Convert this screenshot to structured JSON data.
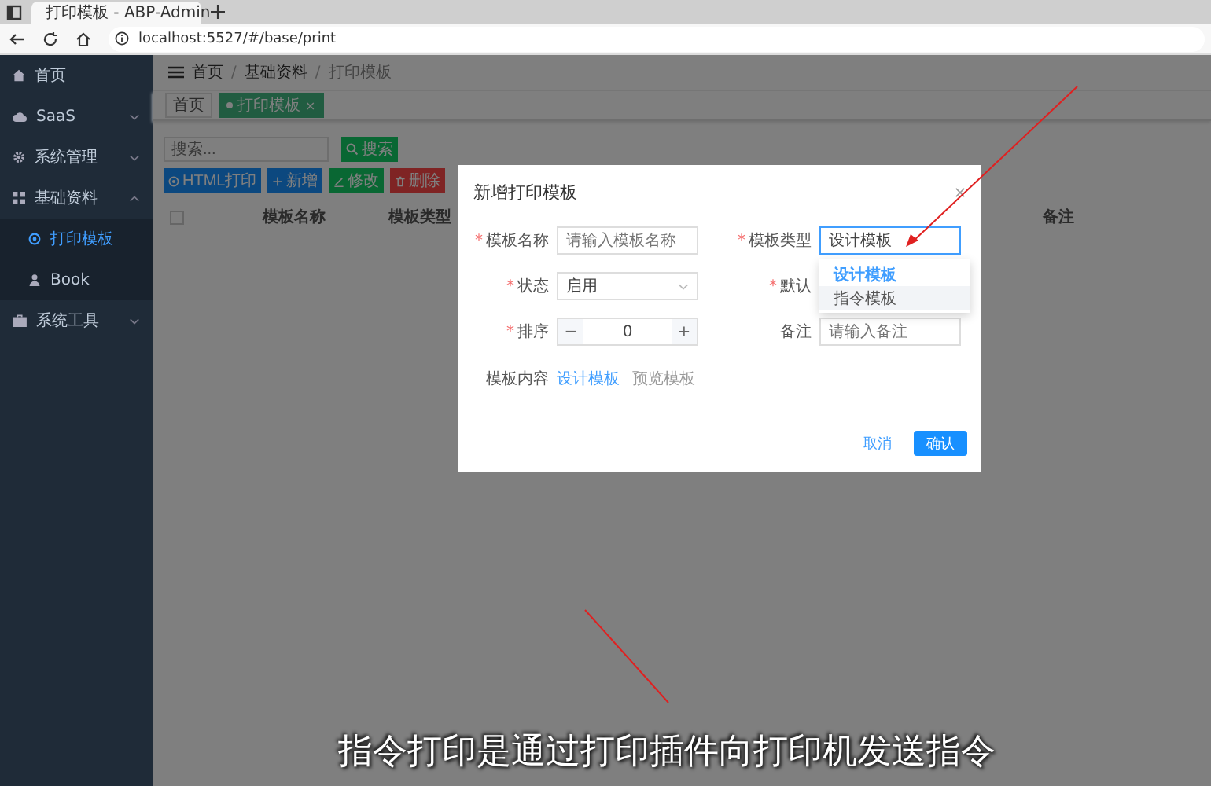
{
  "browser": {
    "tab_title": "打印模板 - ABP-Admin",
    "url": "localhost:5527/#/base/print"
  },
  "sidebar": {
    "items": [
      {
        "label": "首页"
      },
      {
        "label": "SaaS",
        "expanded": false
      },
      {
        "label": "系统管理",
        "expanded": false
      },
      {
        "label": "基础资料",
        "expanded": true,
        "children": [
          {
            "label": "打印模板",
            "selected": true
          },
          {
            "label": "Book",
            "selected": false
          }
        ]
      },
      {
        "label": "系统工具",
        "expanded": false
      }
    ]
  },
  "breadcrumb": {
    "separator": "/",
    "items": [
      "首页",
      "基础资料",
      "打印模板"
    ]
  },
  "tags": [
    {
      "label": "首页",
      "selected": false
    },
    {
      "label": "打印模板",
      "selected": true,
      "close": "×"
    }
  ],
  "search": {
    "placeholder": "搜索...",
    "button": "搜索"
  },
  "toolbar": [
    {
      "label": "HTML打印",
      "kind": "print"
    },
    {
      "label": "新增",
      "kind": "add"
    },
    {
      "label": "修改",
      "kind": "edit"
    },
    {
      "label": "删除",
      "kind": "delete"
    }
  ],
  "table": {
    "select_all": {
      "checked": false
    },
    "columns": [
      "模板名称",
      "模板类型",
      "备注"
    ]
  },
  "dialog": {
    "title": "新增打印模板",
    "required_mark": "*",
    "name": {
      "label": "模板名称",
      "required": true,
      "placeholder": "请输入模板名称"
    },
    "type": {
      "label": "模板类型",
      "required": true,
      "value": "设计模板",
      "options": [
        {
          "label": "设计模板",
          "selected": true
        },
        {
          "label": "指令模板",
          "selected": false
        }
      ]
    },
    "status": {
      "label": "状态",
      "required": true,
      "value": "启用"
    },
    "default": {
      "label": "默认",
      "required": true
    },
    "sort": {
      "label": "排序",
      "required": true,
      "value": "0",
      "minus": "−",
      "plus": "+"
    },
    "remark": {
      "label": "备注",
      "required": false,
      "placeholder": "请输入备注"
    },
    "content": {
      "label": "模板内容",
      "links": [
        {
          "label": "设计模板",
          "selected": true
        },
        {
          "label": "预览模板",
          "selected": false
        }
      ]
    },
    "cancel": "取消",
    "confirm": "确认"
  },
  "subtitle": "指令打印是通过打印插件向打印机发送指令"
}
